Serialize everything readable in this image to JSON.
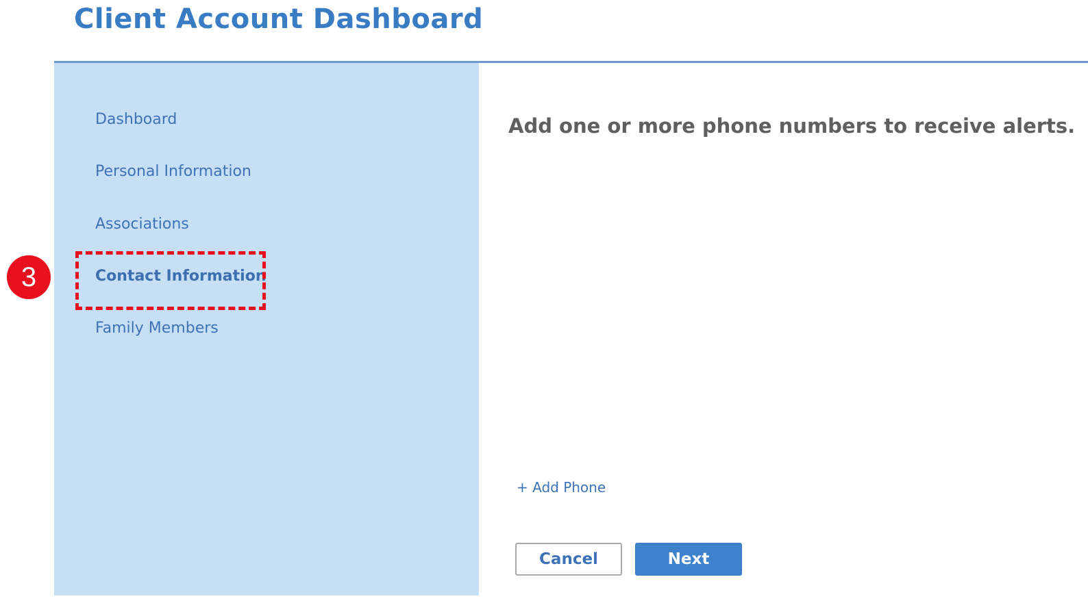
{
  "header": {
    "title": "Client Account Dashboard"
  },
  "sidebar": {
    "items": [
      {
        "label": "Dashboard"
      },
      {
        "label": "Personal Information"
      },
      {
        "label": "Associations"
      },
      {
        "label": "Contact Information"
      },
      {
        "label": "Family Members"
      }
    ],
    "active_item": "Contact Information"
  },
  "annotation": {
    "step_number": "3",
    "highlight_color": "#e8101e"
  },
  "main": {
    "instructions": "Add one or more phone numbers to receive alerts.",
    "add_phone_label": "+ Add Phone",
    "cancel_label": "Cancel",
    "next_label": "Next"
  },
  "colors": {
    "brand_blue": "#3a7cc3",
    "sidebar_bg": "#c7dff4",
    "primary_button": "#3e82cc",
    "link_text": "#3d73b6"
  }
}
